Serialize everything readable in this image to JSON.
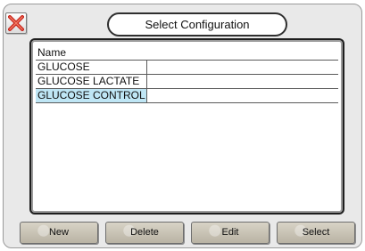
{
  "dialog": {
    "title": "Select Configuration",
    "close_icon": "close-x-icon"
  },
  "list": {
    "column_header": "Name",
    "rows": [
      {
        "name": "GLUCOSE",
        "selected": false
      },
      {
        "name": "GLUCOSE LACTATE",
        "selected": false
      },
      {
        "name": "GLUCOSE CONTROL",
        "selected": true
      }
    ],
    "selection_color": "#bfe6f5"
  },
  "buttons": {
    "new_label": "New",
    "delete_label": "Delete",
    "edit_label": "Edit",
    "select_label": "Select"
  }
}
